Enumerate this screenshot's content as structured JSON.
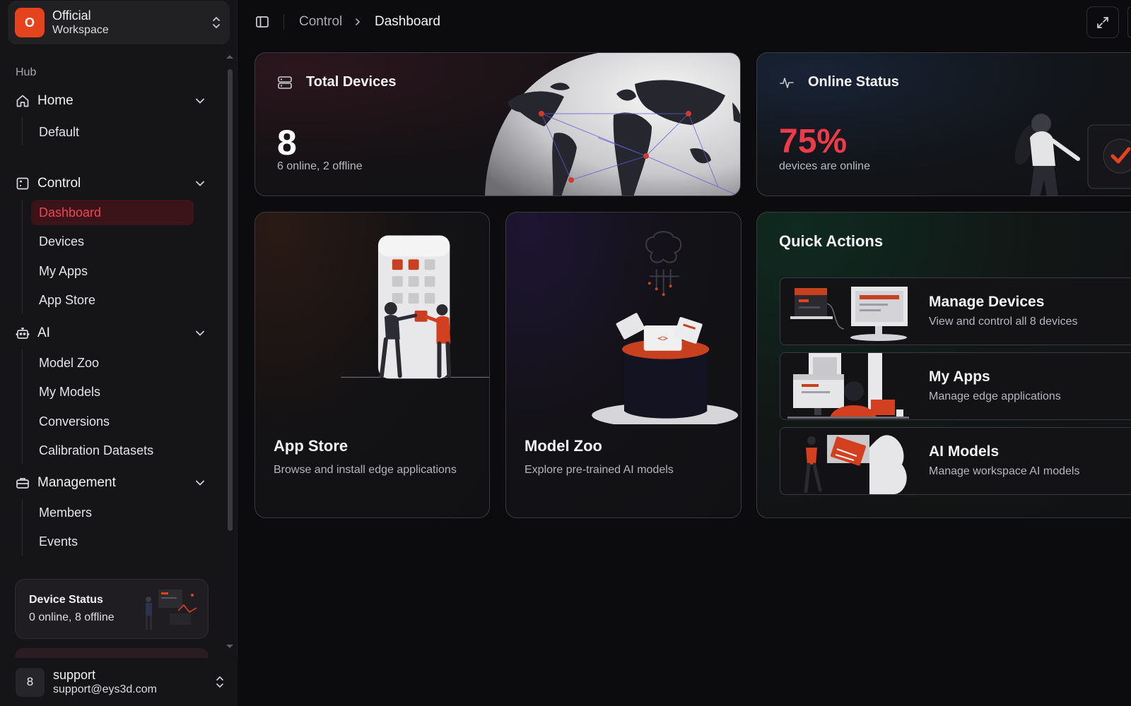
{
  "workspace": {
    "logo_letter": "O",
    "name": "Official",
    "subtitle": "Workspace"
  },
  "sidebar": {
    "section_label": "Hub",
    "groups": [
      {
        "label": "Home",
        "icon": "home-icon",
        "items": [
          "Default"
        ]
      },
      {
        "label": "Control",
        "icon": "control-panel-icon",
        "items": [
          "Dashboard",
          "Devices",
          "My Apps",
          "App Store"
        ],
        "active_item": "Dashboard"
      },
      {
        "label": "AI",
        "icon": "robot-icon",
        "items": [
          "Model Zoo",
          "My Models",
          "Conversions",
          "Calibration Datasets"
        ]
      },
      {
        "label": "Management",
        "icon": "briefcase-icon",
        "items": [
          "Members",
          "Events"
        ]
      }
    ],
    "device_status": {
      "title": "Device Status",
      "summary": "0 online, 8 offline"
    },
    "user": {
      "avatar_letter": "8",
      "name": "support",
      "email": "support@eys3d.com"
    }
  },
  "header": {
    "breadcrumb": [
      "Control",
      "Dashboard"
    ],
    "icons": [
      "sidebar-toggle-icon",
      "chevron-right-icon",
      "expand-icon"
    ]
  },
  "cards": {
    "total_devices": {
      "title": "Total Devices",
      "value": "8",
      "subtitle": "6 online, 2 offline",
      "icon": "server-icon"
    },
    "online_status": {
      "title": "Online Status",
      "value": "75%",
      "subtitle": "devices are online",
      "icon": "activity-icon"
    },
    "app_store": {
      "title": "App Store",
      "subtitle": "Browse and install edge applications"
    },
    "model_zoo": {
      "title": "Model Zoo",
      "subtitle": "Explore pre-trained AI models"
    },
    "quick_actions": {
      "title": "Quick Actions",
      "items": [
        {
          "title": "Manage Devices",
          "subtitle": "View and control all 8 devices"
        },
        {
          "title": "My Apps",
          "subtitle": "Manage edge applications"
        },
        {
          "title": "AI Models",
          "subtitle": "Manage workspace AI models"
        }
      ]
    }
  },
  "colors": {
    "accent": "#e5421e",
    "danger": "#ef3b48",
    "active_bg": "#3b1419",
    "background": "#0c0c0e"
  }
}
